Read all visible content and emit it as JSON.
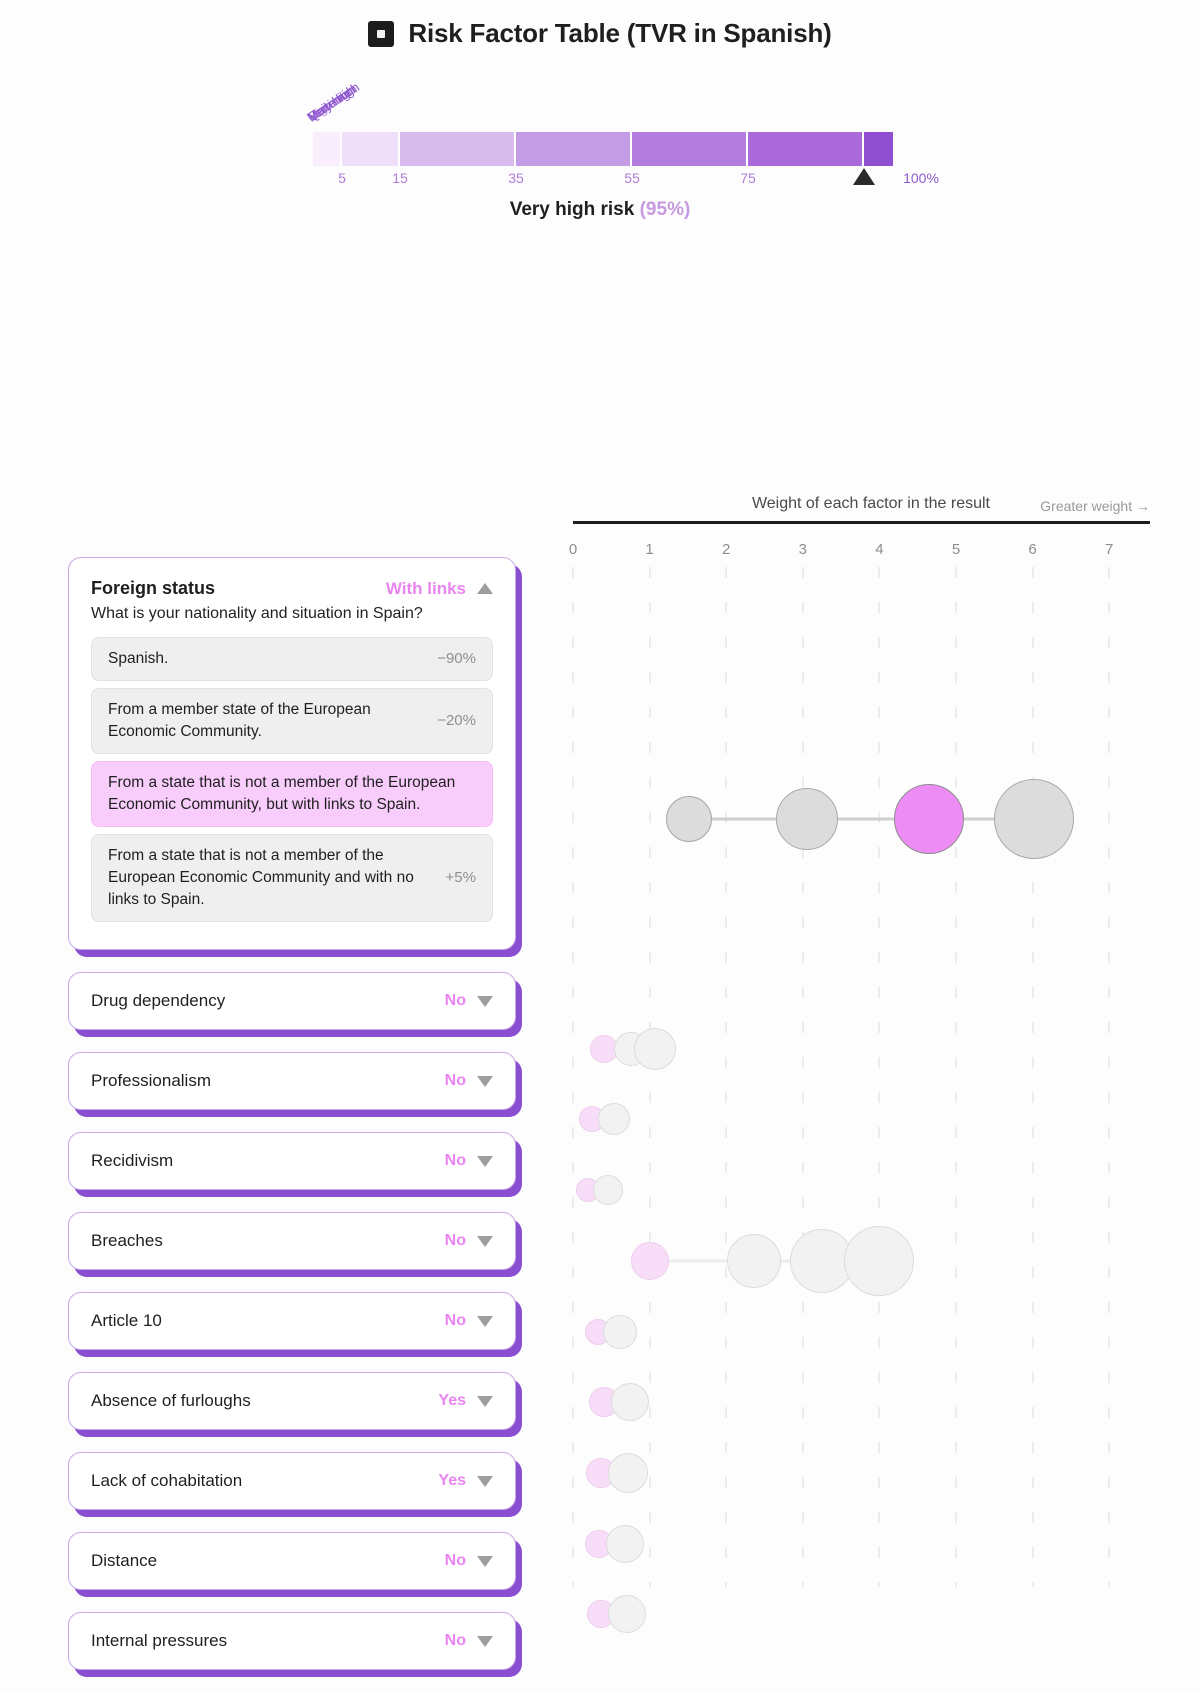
{
  "title": {
    "text": "Risk Factor Table (TVR in Spanish)",
    "icon": "square-dot-icon"
  },
  "gauge": {
    "segments": [
      {
        "label": "Very low",
        "from": 0,
        "to": 5,
        "color": "#f9effc"
      },
      {
        "label": "Low",
        "from": 5,
        "to": 15,
        "color": "#f0dff9"
      },
      {
        "label": "Normal",
        "from": 15,
        "to": 35,
        "color": "#d8bcee"
      },
      {
        "label": "High",
        "from": 35,
        "to": 55,
        "color": "#c49ce6"
      },
      {
        "label": "Quite high",
        "from": 55,
        "to": 75,
        "color": "#b37ddf"
      },
      {
        "label": "Very high",
        "from": 75,
        "to": 95,
        "color": "#a969d8"
      },
      {
        "label": "Maximum",
        "from": 95,
        "to": 100,
        "color": "#8f4fd0"
      }
    ],
    "ticks": [
      {
        "value": 5,
        "label": "5"
      },
      {
        "value": 15,
        "label": "15"
      },
      {
        "value": 35,
        "label": "35"
      },
      {
        "value": 55,
        "label": "55"
      },
      {
        "value": 75,
        "label": "75"
      },
      {
        "value": 95,
        "label": ""
      },
      {
        "value": 100,
        "label": "100%"
      }
    ],
    "marker_value": 95,
    "result_label": "Very high risk",
    "result_percent": "(95%)",
    "accent_color": "#c79ae0"
  },
  "chart_header": {
    "caption": "Weight of each factor in the result",
    "greater_weight": "Greater weight →"
  },
  "chart_data": {
    "type": "scatter",
    "title": "Weight of each factor in the result",
    "xlabel": "",
    "ylabel": "",
    "xlim": [
      0,
      7.35
    ],
    "grid": true,
    "legend": null,
    "x_ticks": [
      "0",
      "1",
      "2",
      "3",
      "4",
      "5",
      "6",
      "7"
    ],
    "rows": [
      {
        "factor": "Foreign status",
        "active": true,
        "points": [
          {
            "x": 1.51,
            "r": 23,
            "selected": false
          },
          {
            "x": 3.06,
            "r": 31,
            "selected": false
          },
          {
            "x": 4.65,
            "r": 35,
            "selected": true
          },
          {
            "x": 6.02,
            "r": 40,
            "selected": false
          }
        ]
      },
      {
        "factor": "Drug dependency",
        "active": false,
        "points": [
          {
            "x": 0.4,
            "r": 14,
            "selected": true
          },
          {
            "x": 0.76,
            "r": 17,
            "selected": false
          },
          {
            "x": 1.07,
            "r": 21,
            "selected": false
          }
        ]
      },
      {
        "factor": "Professionalism",
        "active": false,
        "points": [
          {
            "x": 0.25,
            "r": 13,
            "selected": true
          },
          {
            "x": 0.54,
            "r": 16,
            "selected": false
          }
        ]
      },
      {
        "factor": "Recidivism",
        "active": false,
        "points": [
          {
            "x": 0.2,
            "r": 12,
            "selected": true
          },
          {
            "x": 0.46,
            "r": 15,
            "selected": false
          }
        ]
      },
      {
        "factor": "Breaches",
        "active": false,
        "points": [
          {
            "x": 1.0,
            "r": 19,
            "selected": true
          },
          {
            "x": 2.36,
            "r": 27,
            "selected": false
          },
          {
            "x": 3.25,
            "r": 32,
            "selected": false
          },
          {
            "x": 4.0,
            "r": 35,
            "selected": false
          }
        ]
      },
      {
        "factor": "Article 10",
        "active": false,
        "points": [
          {
            "x": 0.32,
            "r": 13,
            "selected": true
          },
          {
            "x": 0.62,
            "r": 17,
            "selected": false
          }
        ]
      },
      {
        "factor": "Absence of furloughs",
        "active": false,
        "points": [
          {
            "x": 0.4,
            "r": 15,
            "selected": true
          },
          {
            "x": 0.75,
            "r": 19,
            "selected": false
          }
        ]
      },
      {
        "factor": "Lack of cohabitation",
        "active": false,
        "points": [
          {
            "x": 0.36,
            "r": 15,
            "selected": true
          },
          {
            "x": 0.72,
            "r": 20,
            "selected": false
          }
        ]
      },
      {
        "factor": "Distance",
        "active": false,
        "points": [
          {
            "x": 0.34,
            "r": 14,
            "selected": true
          },
          {
            "x": 0.68,
            "r": 19,
            "selected": false
          }
        ]
      },
      {
        "factor": "Internal pressures",
        "active": false,
        "points": [
          {
            "x": 0.36,
            "r": 14,
            "selected": true
          },
          {
            "x": 0.7,
            "r": 19,
            "selected": false
          }
        ]
      }
    ]
  },
  "factors": [
    {
      "name": "Foreign status",
      "value": "With links",
      "expanded": true,
      "caret": "caret-up",
      "question": "What is your nationality and situation in Spain?",
      "options": [
        {
          "text": "Spanish.",
          "pct": "−90%",
          "selected": false
        },
        {
          "text": "From a member state of the European Economic Community.",
          "pct": "−20%",
          "selected": false
        },
        {
          "text": "From a state that is not a member of the European Economic Community, but with links to Spain.",
          "pct": "",
          "selected": true
        },
        {
          "text": "From a state that is not a member of the European Economic Community and with no links to Spain.",
          "pct": "+5%",
          "selected": false
        }
      ]
    },
    {
      "name": "Drug dependency",
      "value": "No",
      "expanded": false,
      "caret": "caret-down"
    },
    {
      "name": "Professionalism",
      "value": "No",
      "expanded": false,
      "caret": "caret-down"
    },
    {
      "name": "Recidivism",
      "value": "No",
      "expanded": false,
      "caret": "caret-down"
    },
    {
      "name": "Breaches",
      "value": "No",
      "expanded": false,
      "caret": "caret-down"
    },
    {
      "name": "Article 10",
      "value": "No",
      "expanded": false,
      "caret": "caret-down"
    },
    {
      "name": "Absence of furloughs",
      "value": "Yes",
      "expanded": false,
      "caret": "caret-down"
    },
    {
      "name": "Lack of cohabitation",
      "value": "Yes",
      "expanded": false,
      "caret": "caret-down"
    },
    {
      "name": "Distance",
      "value": "No",
      "expanded": false,
      "caret": "caret-down"
    },
    {
      "name": "Internal pressures",
      "value": "No",
      "expanded": false,
      "caret": "caret-down"
    }
  ],
  "colors": {
    "accent_pink": "#e884f0",
    "bubble_active": "#ee8cf5",
    "bubble_inactive": "#dcdcdc",
    "card_shadow": "#8a4fd0",
    "card_border": "#c9a8e8",
    "option_selected": "#f8cdfb"
  }
}
